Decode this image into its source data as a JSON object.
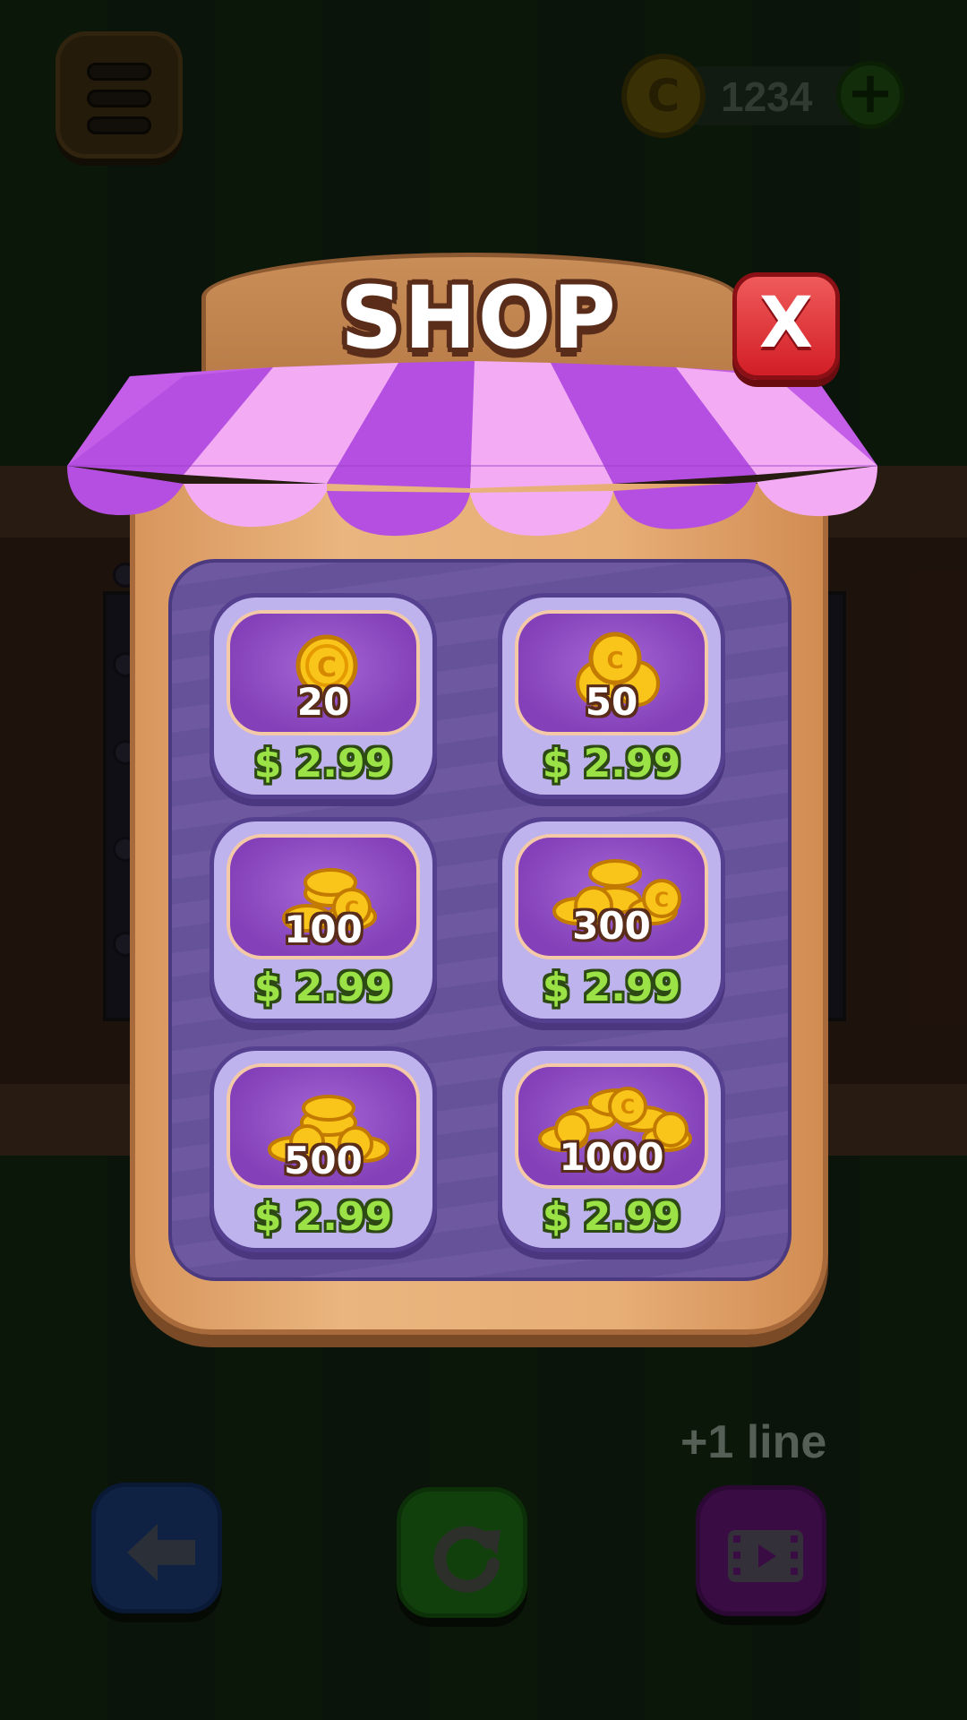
{
  "top_bar": {
    "coin_balance": "1234",
    "menu_icon": "hamburger-menu-icon",
    "coin_icon": "coin-icon",
    "add_icon": "plus-icon"
  },
  "shop": {
    "title": "SHOP",
    "close_label": "X",
    "packs": [
      {
        "amount": "20",
        "price": "$ 2.99"
      },
      {
        "amount": "50",
        "price": "$ 2.99"
      },
      {
        "amount": "100",
        "price": "$ 2.99"
      },
      {
        "amount": "300",
        "price": "$ 2.99"
      },
      {
        "amount": "500",
        "price": "$ 2.99"
      },
      {
        "amount": "1000",
        "price": "$ 2.99"
      }
    ]
  },
  "bottom_bar": {
    "hint_label": "+1 line",
    "back_icon": "arrow-left-icon",
    "restart_icon": "restart-icon",
    "video_icon": "video-ad-icon"
  },
  "colors": {
    "awning_dark": "#b44fe2",
    "awning_light": "#f3acf3",
    "close_red": "#e0262e",
    "price_green": "#9ae245",
    "panel_wood": "#e7ae76",
    "inner_purple": "#6a559f"
  }
}
